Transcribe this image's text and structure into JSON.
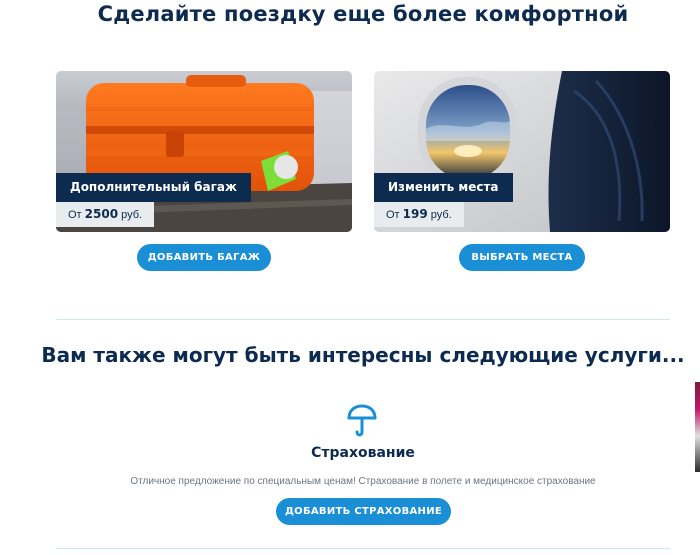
{
  "comfort_section": {
    "title": "Сделайте поездку еще более комфортной",
    "cards": [
      {
        "label": "Дополнительный багаж",
        "price_prefix": "От",
        "price_amount": "2500",
        "price_currency": "руб.",
        "button_label": "ДОБАВИТЬ БАГАЖ",
        "image": "orange-suitcase-photo"
      },
      {
        "label": "Изменить места",
        "price_prefix": "От",
        "price_amount": "199",
        "price_currency": "руб.",
        "button_label": "ВЫБРАТЬ МЕСТА",
        "image": "airplane-window-photo"
      }
    ]
  },
  "services_section": {
    "title": "Вам также могут быть интересны следующие услуги...",
    "service": {
      "icon": "umbrella-icon",
      "title": "Страхование",
      "description": "Отличное предложение по специальным ценам! Страхование в полете и медицинское страхование",
      "button_label": "ДОБАВИТЬ СТРАХОВАНИЕ"
    }
  },
  "colors": {
    "navy": "#0d2a4f",
    "button_blue": "#1a8fd6",
    "price_bg": "#e9ecef",
    "divider": "#cfe6f3"
  }
}
